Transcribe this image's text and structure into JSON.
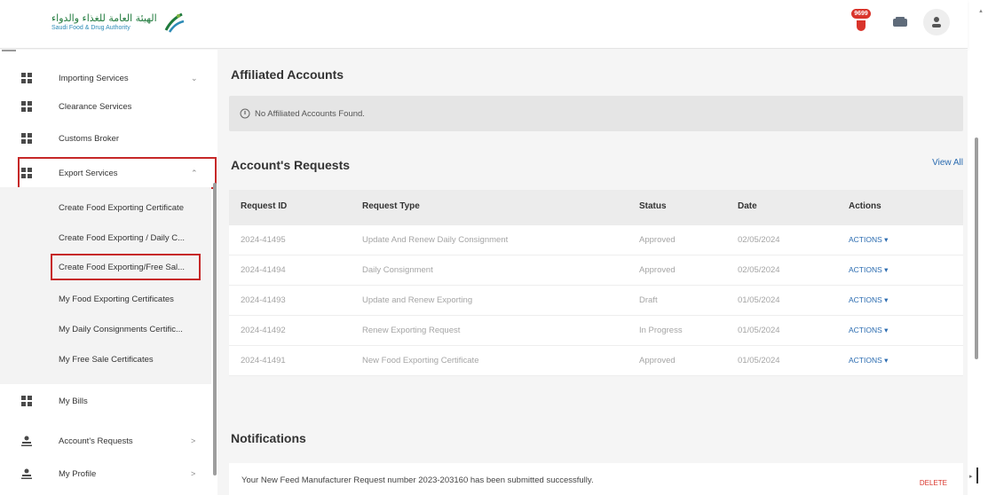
{
  "header": {
    "logo_ar": "الهيئة العامة للغذاء والدواء",
    "logo_en": "Saudi Food & Drug Authority",
    "notif_count": "9699",
    "colors": {
      "brand_green": "#1f7a3c",
      "brand_blue": "#2d8bb6",
      "badge_red": "#d9342b"
    }
  },
  "sidebar": {
    "items": [
      {
        "label": "Importing Services",
        "chevron": "⌄",
        "icon": "grid-icon"
      },
      {
        "label": "Clearance Services",
        "chevron": "",
        "icon": "grid-icon"
      },
      {
        "label": "Customs Broker",
        "chevron": "",
        "icon": "grid-icon"
      },
      {
        "label": "Export Services",
        "chevron": "⌃",
        "icon": "grid-icon"
      }
    ],
    "submenu": [
      {
        "label": "Create Food Exporting Certificate"
      },
      {
        "label": "Create Food Exporting / Daily C..."
      },
      {
        "label": "Create Food Exporting/Free Sal..."
      },
      {
        "label": "My Food Exporting Certificates"
      },
      {
        "label": "My Daily Consignments Certific..."
      },
      {
        "label": "My Free Sale Certificates"
      }
    ],
    "bottom": [
      {
        "label": "My Bills",
        "chevron": "",
        "icon": "grid-icon"
      },
      {
        "label": "Account's Requests",
        "chevron": ">",
        "icon": "person-icon"
      },
      {
        "label": "My Profile",
        "chevron": ">",
        "icon": "person-icon"
      }
    ]
  },
  "main": {
    "affiliated_title": "Affiliated Accounts",
    "affiliated_empty": "No Affiliated Accounts Found.",
    "requests_title": "Account's Requests",
    "view_all": "View All",
    "columns": [
      "Request ID",
      "Request Type",
      "Status",
      "Date",
      "Actions"
    ],
    "rows": [
      {
        "id": "2024-41495",
        "type": "Update And Renew Daily Consignment",
        "status": "Approved",
        "date": "02/05/2024",
        "action": "ACTIONS ▾"
      },
      {
        "id": "2024-41494",
        "type": "Daily Consignment",
        "status": "Approved",
        "date": "02/05/2024",
        "action": "ACTIONS ▾"
      },
      {
        "id": "2024-41493",
        "type": "Update and Renew Exporting",
        "status": "Draft",
        "date": "01/05/2024",
        "action": "ACTIONS ▾"
      },
      {
        "id": "2024-41492",
        "type": "Renew Exporting Request",
        "status": "In Progress",
        "date": "01/05/2024",
        "action": "ACTIONS ▾"
      },
      {
        "id": "2024-41491",
        "type": "New Food Exporting Certificate",
        "status": "Approved",
        "date": "01/05/2024",
        "action": "ACTIONS ▾"
      }
    ],
    "notifications_title": "Notifications",
    "notification_message": "Your New Feed Manufacturer Request number 2023-203160 has been submitted successfully.",
    "notification_delete": "DELETE"
  }
}
